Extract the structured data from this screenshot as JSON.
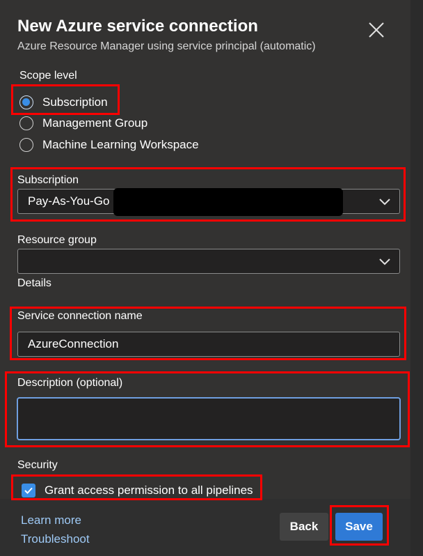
{
  "dialog": {
    "title": "New Azure service connection",
    "subtitle": "Azure Resource Manager using service principal (automatic)",
    "close_icon": "close-icon"
  },
  "scope": {
    "label": "Scope level",
    "options": [
      {
        "label": "Subscription",
        "checked": true
      },
      {
        "label": "Management Group",
        "checked": false
      },
      {
        "label": "Machine Learning Workspace",
        "checked": false
      }
    ]
  },
  "subscription": {
    "label": "Subscription",
    "value": "Pay-As-You-Go ("
  },
  "resource_group": {
    "label": "Resource group",
    "value": ""
  },
  "details": {
    "label": "Details"
  },
  "service_connection_name": {
    "label": "Service connection name",
    "value": "AzureConnection"
  },
  "description": {
    "label": "Description (optional)",
    "value": ""
  },
  "security": {
    "label": "Security",
    "grant_access_label": "Grant access permission to all pipelines",
    "grant_access_checked": true
  },
  "footer": {
    "learn_more": "Learn more",
    "troubleshoot": "Troubleshoot",
    "back_label": "Back",
    "save_label": "Save"
  },
  "colors": {
    "accent": "#2f7ad6",
    "highlight": "#ff0000",
    "background": "#333231"
  }
}
